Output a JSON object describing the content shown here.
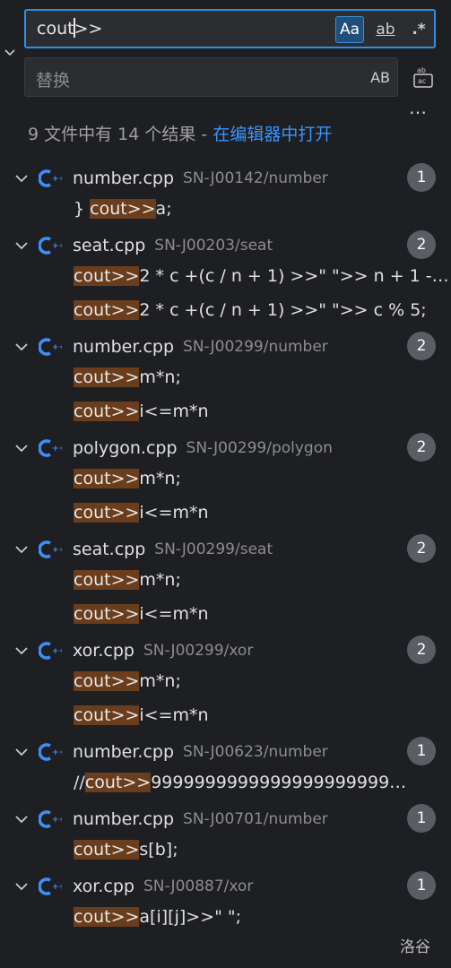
{
  "search": {
    "value_before_caret": "cout",
    "value_after_caret": ">>",
    "match_case": "Aa",
    "whole_word": "ab",
    "regex": ".*"
  },
  "replace": {
    "placeholder": "替换",
    "preserve_case": "AB"
  },
  "more_label": "…",
  "summary": {
    "prefix": "9 文件中有 14 个结果 - ",
    "link": "在编辑器中打开"
  },
  "results": [
    {
      "file": "number.cpp",
      "path": "SN-J00142/number",
      "count": "1",
      "matches": [
        {
          "pre": "} ",
          "hl": "cout>>",
          "post": "a;"
        }
      ]
    },
    {
      "file": "seat.cpp",
      "path": "SN-J00203/seat",
      "count": "2",
      "matches": [
        {
          "pre": "",
          "hl": "cout>>",
          "post": "2 * c +(c / n + 1) >>\" \">> n + 1 - (…"
        },
        {
          "pre": "",
          "hl": "cout>>",
          "post": "2 * c +(c / n + 1) >>\" \">> c % 5;"
        }
      ]
    },
    {
      "file": "number.cpp",
      "path": "SN-J00299/number",
      "count": "2",
      "matches": [
        {
          "pre": "",
          "hl": "cout>>",
          "post": "m*n;"
        },
        {
          "pre": "",
          "hl": "cout>>",
          "post": "i<=m*n"
        }
      ]
    },
    {
      "file": "polygon.cpp",
      "path": "SN-J00299/polygon",
      "count": "2",
      "matches": [
        {
          "pre": "",
          "hl": "cout>>",
          "post": "m*n;"
        },
        {
          "pre": "",
          "hl": "cout>>",
          "post": "i<=m*n"
        }
      ]
    },
    {
      "file": "seat.cpp",
      "path": "SN-J00299/seat",
      "count": "2",
      "matches": [
        {
          "pre": "",
          "hl": "cout>>",
          "post": "m*n;"
        },
        {
          "pre": "",
          "hl": "cout>>",
          "post": "i<=m*n"
        }
      ]
    },
    {
      "file": "xor.cpp",
      "path": "SN-J00299/xor",
      "count": "2",
      "matches": [
        {
          "pre": "",
          "hl": "cout>>",
          "post": "m*n;"
        },
        {
          "pre": "",
          "hl": "cout>>",
          "post": "i<=m*n"
        }
      ]
    },
    {
      "file": "number.cpp",
      "path": "SN-J00623/number",
      "count": "1",
      "matches": [
        {
          "pre": "//",
          "hl": "cout>>",
          "post": "9999999999999999999999…"
        }
      ]
    },
    {
      "file": "number.cpp",
      "path": "SN-J00701/number",
      "count": "1",
      "matches": [
        {
          "pre": "",
          "hl": "cout>>",
          "post": "s[b];"
        }
      ]
    },
    {
      "file": "xor.cpp",
      "path": "SN-J00887/xor",
      "count": "1",
      "matches": [
        {
          "pre": "",
          "hl": "cout>>",
          "post": "a[i][j]>>\" \";"
        }
      ]
    }
  ],
  "icon_names": {
    "file": "cpp-file-icon",
    "expand": "chevron-down-icon",
    "replace_all": "replace-all-icon"
  },
  "colors": {
    "accent": "#2f8fe6",
    "highlight": "#6a3d1c",
    "cpp_icon": "#3e8ef7",
    "link": "#3794ff"
  },
  "watermark": "洛谷"
}
